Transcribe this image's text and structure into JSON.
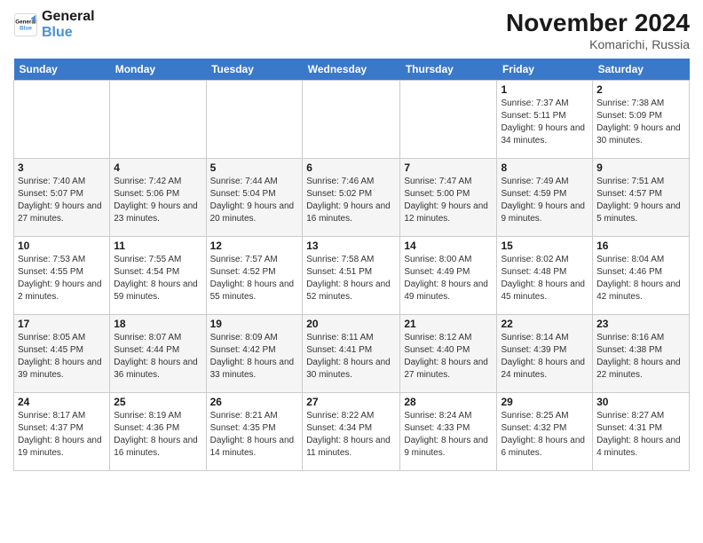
{
  "header": {
    "logo": {
      "text_general": "General",
      "text_blue": "Blue"
    },
    "title": "November 2024",
    "location": "Komarichi, Russia"
  },
  "weekdays": [
    "Sunday",
    "Monday",
    "Tuesday",
    "Wednesday",
    "Thursday",
    "Friday",
    "Saturday"
  ],
  "weeks": [
    [
      {
        "day": "",
        "info": ""
      },
      {
        "day": "",
        "info": ""
      },
      {
        "day": "",
        "info": ""
      },
      {
        "day": "",
        "info": ""
      },
      {
        "day": "",
        "info": ""
      },
      {
        "day": "1",
        "info": "Sunrise: 7:37 AM\nSunset: 5:11 PM\nDaylight: 9 hours and 34 minutes."
      },
      {
        "day": "2",
        "info": "Sunrise: 7:38 AM\nSunset: 5:09 PM\nDaylight: 9 hours and 30 minutes."
      }
    ],
    [
      {
        "day": "3",
        "info": "Sunrise: 7:40 AM\nSunset: 5:07 PM\nDaylight: 9 hours and 27 minutes."
      },
      {
        "day": "4",
        "info": "Sunrise: 7:42 AM\nSunset: 5:06 PM\nDaylight: 9 hours and 23 minutes."
      },
      {
        "day": "5",
        "info": "Sunrise: 7:44 AM\nSunset: 5:04 PM\nDaylight: 9 hours and 20 minutes."
      },
      {
        "day": "6",
        "info": "Sunrise: 7:46 AM\nSunset: 5:02 PM\nDaylight: 9 hours and 16 minutes."
      },
      {
        "day": "7",
        "info": "Sunrise: 7:47 AM\nSunset: 5:00 PM\nDaylight: 9 hours and 12 minutes."
      },
      {
        "day": "8",
        "info": "Sunrise: 7:49 AM\nSunset: 4:59 PM\nDaylight: 9 hours and 9 minutes."
      },
      {
        "day": "9",
        "info": "Sunrise: 7:51 AM\nSunset: 4:57 PM\nDaylight: 9 hours and 5 minutes."
      }
    ],
    [
      {
        "day": "10",
        "info": "Sunrise: 7:53 AM\nSunset: 4:55 PM\nDaylight: 9 hours and 2 minutes."
      },
      {
        "day": "11",
        "info": "Sunrise: 7:55 AM\nSunset: 4:54 PM\nDaylight: 8 hours and 59 minutes."
      },
      {
        "day": "12",
        "info": "Sunrise: 7:57 AM\nSunset: 4:52 PM\nDaylight: 8 hours and 55 minutes."
      },
      {
        "day": "13",
        "info": "Sunrise: 7:58 AM\nSunset: 4:51 PM\nDaylight: 8 hours and 52 minutes."
      },
      {
        "day": "14",
        "info": "Sunrise: 8:00 AM\nSunset: 4:49 PM\nDaylight: 8 hours and 49 minutes."
      },
      {
        "day": "15",
        "info": "Sunrise: 8:02 AM\nSunset: 4:48 PM\nDaylight: 8 hours and 45 minutes."
      },
      {
        "day": "16",
        "info": "Sunrise: 8:04 AM\nSunset: 4:46 PM\nDaylight: 8 hours and 42 minutes."
      }
    ],
    [
      {
        "day": "17",
        "info": "Sunrise: 8:05 AM\nSunset: 4:45 PM\nDaylight: 8 hours and 39 minutes."
      },
      {
        "day": "18",
        "info": "Sunrise: 8:07 AM\nSunset: 4:44 PM\nDaylight: 8 hours and 36 minutes."
      },
      {
        "day": "19",
        "info": "Sunrise: 8:09 AM\nSunset: 4:42 PM\nDaylight: 8 hours and 33 minutes."
      },
      {
        "day": "20",
        "info": "Sunrise: 8:11 AM\nSunset: 4:41 PM\nDaylight: 8 hours and 30 minutes."
      },
      {
        "day": "21",
        "info": "Sunrise: 8:12 AM\nSunset: 4:40 PM\nDaylight: 8 hours and 27 minutes."
      },
      {
        "day": "22",
        "info": "Sunrise: 8:14 AM\nSunset: 4:39 PM\nDaylight: 8 hours and 24 minutes."
      },
      {
        "day": "23",
        "info": "Sunrise: 8:16 AM\nSunset: 4:38 PM\nDaylight: 8 hours and 22 minutes."
      }
    ],
    [
      {
        "day": "24",
        "info": "Sunrise: 8:17 AM\nSunset: 4:37 PM\nDaylight: 8 hours and 19 minutes."
      },
      {
        "day": "25",
        "info": "Sunrise: 8:19 AM\nSunset: 4:36 PM\nDaylight: 8 hours and 16 minutes."
      },
      {
        "day": "26",
        "info": "Sunrise: 8:21 AM\nSunset: 4:35 PM\nDaylight: 8 hours and 14 minutes."
      },
      {
        "day": "27",
        "info": "Sunrise: 8:22 AM\nSunset: 4:34 PM\nDaylight: 8 hours and 11 minutes."
      },
      {
        "day": "28",
        "info": "Sunrise: 8:24 AM\nSunset: 4:33 PM\nDaylight: 8 hours and 9 minutes."
      },
      {
        "day": "29",
        "info": "Sunrise: 8:25 AM\nSunset: 4:32 PM\nDaylight: 8 hours and 6 minutes."
      },
      {
        "day": "30",
        "info": "Sunrise: 8:27 AM\nSunset: 4:31 PM\nDaylight: 8 hours and 4 minutes."
      }
    ]
  ]
}
